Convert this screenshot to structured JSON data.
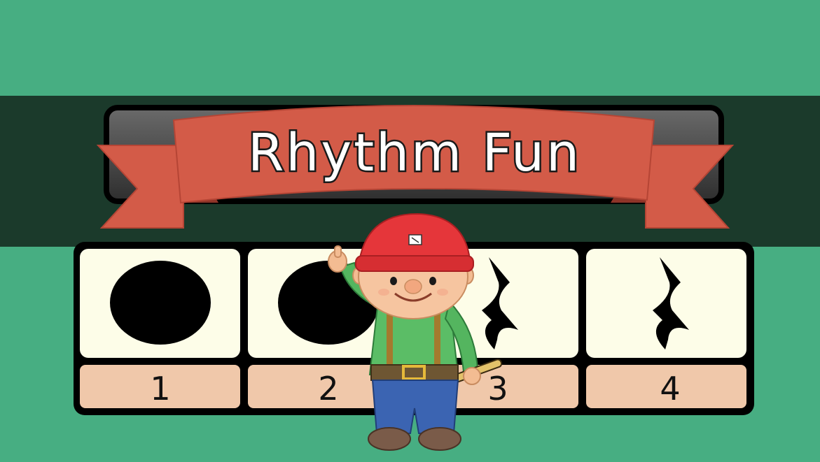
{
  "title": "Rhythm Fun",
  "beats": [
    {
      "number": "1",
      "symbol": "quarter-note-head-icon"
    },
    {
      "number": "2",
      "symbol": "quarter-note-head-icon"
    },
    {
      "number": "3",
      "symbol": "quarter-rest-icon"
    },
    {
      "number": "4",
      "symbol": "quarter-rest-icon"
    }
  ],
  "colors": {
    "background": "#47ae82",
    "band": "#1b3a2b",
    "ribbon": "#d35b48",
    "card": "#fdfde8",
    "number_strip": "#f0c8aa"
  }
}
